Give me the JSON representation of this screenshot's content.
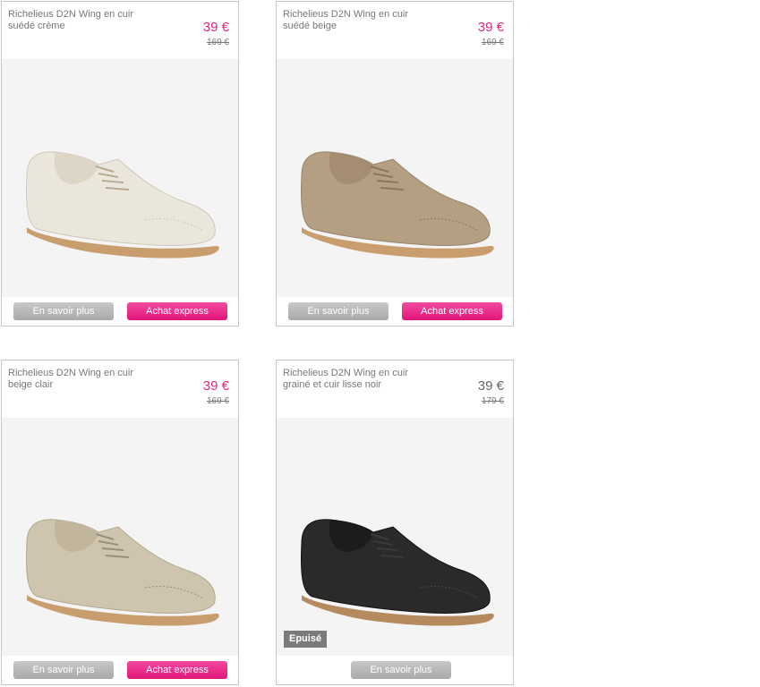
{
  "products": [
    {
      "title": "Richelieus D2N Wing en cuir suédé crème",
      "price": "39 €",
      "old_price": "169 €",
      "more_label": "En savoir plus",
      "express_label": "Achat express",
      "upper_color": "#ebe6dc",
      "lace_color": "#b9aa94"
    },
    {
      "title": "Richelieus D2N Wing en cuir suédé beige",
      "price": "39 €",
      "old_price": "169 €",
      "more_label": "En savoir plus",
      "express_label": "Achat express",
      "upper_color": "#b59f82",
      "lace_color": "#8a7762"
    },
    {
      "title": "Richelieus D2N Wing en cuir beige clair",
      "price": "39 €",
      "old_price": "169 €",
      "more_label": "En savoir plus",
      "express_label": "Achat express",
      "upper_color": "#cfc4ae",
      "lace_color": "#9a8f7c"
    },
    {
      "title": "Richelieus D2N Wing en cuir grainé et cuir lisse noir",
      "price": "39 €",
      "old_price": "179 €",
      "more_label": "En savoir plus",
      "status_badge": "Epuisé",
      "upper_color": "#2a2a28",
      "lace_color": "#3a3a38"
    }
  ],
  "colors": {
    "accent_pink": "#e5267f",
    "button_grey": "#aaaaaa",
    "sole": "#c79a68",
    "card_border": "#c6c6c6"
  }
}
